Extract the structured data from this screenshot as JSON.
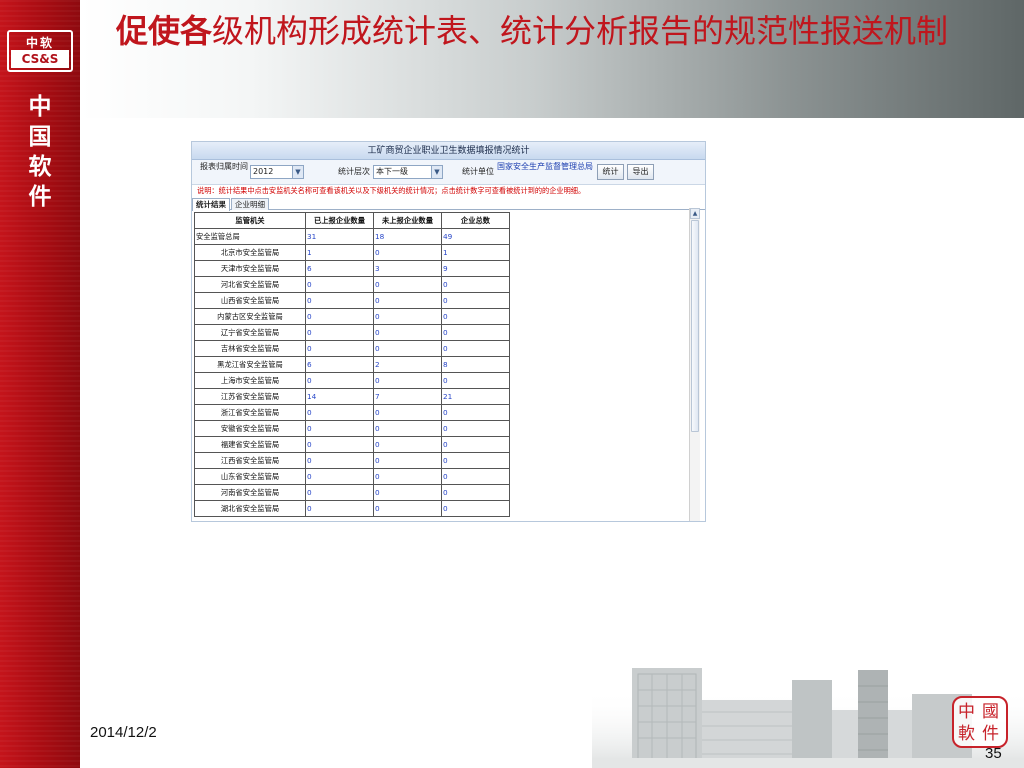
{
  "slide": {
    "title_strong": "促使各",
    "title_rest": "级机构形成统计表、统计分析报告的规范性报送机制",
    "date": "2014/12/2",
    "page_number": "35"
  },
  "brand": {
    "logo_cn": "中软",
    "logo_en": "CS&S",
    "vertical_name": [
      "中",
      "国",
      "软",
      "件"
    ],
    "seal_chars": [
      "中",
      "國",
      "軟",
      "件"
    ]
  },
  "screenshot": {
    "window_title": "工矿商贸企业职业卫生数据填报情况统计",
    "filters": {
      "year_label": "报表归属时间",
      "year_value": "2012",
      "level_label": "统计层次",
      "level_value": "本下一级",
      "unit_label": "统计单位",
      "unit_value": "国家安全生产监督管理总局",
      "stat_button": "统计",
      "export_button": "导出"
    },
    "notice": "说明：统计结果中点击安监机关名称可查看该机关以及下级机关的统计情况；点击统计数字可查看被统计到的的企业明细。",
    "tabs": [
      "统计结果",
      "企业明细"
    ],
    "table": {
      "headers": [
        "监管机关",
        "已上报企业数量",
        "未上报企业数量",
        "企业总数"
      ],
      "rows": [
        [
          "安全监管总局",
          "31",
          "18",
          "49"
        ],
        [
          "北京市安全监管局",
          "1",
          "0",
          "1"
        ],
        [
          "天津市安全监管局",
          "6",
          "3",
          "9"
        ],
        [
          "河北省安全监管局",
          "0",
          "0",
          "0"
        ],
        [
          "山西省安全监管局",
          "0",
          "0",
          "0"
        ],
        [
          "内蒙古区安全监管局",
          "0",
          "0",
          "0"
        ],
        [
          "辽宁省安全监管局",
          "0",
          "0",
          "0"
        ],
        [
          "吉林省安全监管局",
          "0",
          "0",
          "0"
        ],
        [
          "黑龙江省安全监管局",
          "6",
          "2",
          "8"
        ],
        [
          "上海市安全监管局",
          "0",
          "0",
          "0"
        ],
        [
          "江苏省安全监管局",
          "14",
          "7",
          "21"
        ],
        [
          "浙江省安全监管局",
          "0",
          "0",
          "0"
        ],
        [
          "安徽省安全监管局",
          "0",
          "0",
          "0"
        ],
        [
          "福建省安全监管局",
          "0",
          "0",
          "0"
        ],
        [
          "江西省安全监管局",
          "0",
          "0",
          "0"
        ],
        [
          "山东省安全监管局",
          "0",
          "0",
          "0"
        ],
        [
          "河南省安全监管局",
          "0",
          "0",
          "0"
        ],
        [
          "湖北省安全监管局",
          "0",
          "0",
          "0"
        ]
      ]
    }
  },
  "colors": {
    "accent_red": "#c0161d",
    "link_blue": "#2a48c8",
    "panel_blue": "#c8d9ef"
  }
}
